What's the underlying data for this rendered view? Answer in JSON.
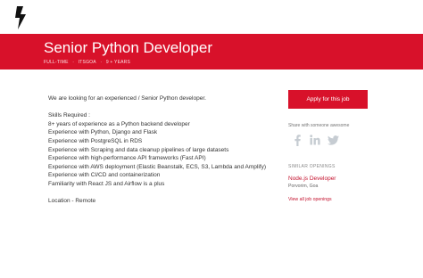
{
  "header": {
    "logo_icon": "lightning-bolt-logo",
    "title": "Senior Python Developer",
    "meta": [
      "FULL-TIME",
      "·",
      "ITSGOA",
      "·",
      "9 + YEARS"
    ]
  },
  "description": {
    "intro": "We are looking for an experienced / Senior Python developer.",
    "skills_heading": "Skills Required :",
    "skills": [
      " 8+ years of experience as a Python backend developer",
      " Experience with Python, Django and Flask",
      " Experience with PostgreSQL in RDS",
      " Experience with Scraping and data cleanup pipelines of large datasets",
      " Experience with high-performance API frameworks (Fast API)",
      " Experience with AWS deployment (Elastic Beanstalk, ECS, S3, Lambda and Amplify)",
      "Experience with CI/CD and containerization",
      " Familiarity with React JS and Airflow is a plus"
    ],
    "location": "Location - Remote"
  },
  "sidebar": {
    "apply_label": "Apply for this job",
    "share_label": "Share with someone awesome",
    "share_icons": [
      "facebook-icon",
      "linkedin-icon",
      "twitter-icon"
    ],
    "similar_label": "SIMILAR OPENINGS",
    "similar_jobs": [
      {
        "title": "Node.js Developer",
        "location": "Porvorim, Goa"
      }
    ],
    "all_openings_label": "View all job openings"
  },
  "colors": {
    "brand": "#d8112a",
    "icon_gray": "#c6ccd2"
  }
}
